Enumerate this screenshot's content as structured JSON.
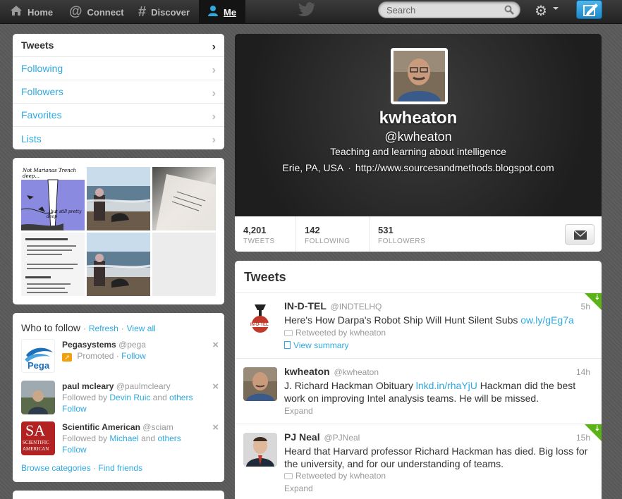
{
  "nav": {
    "home": "Home",
    "connect": "Connect",
    "discover": "Discover",
    "me": "Me"
  },
  "search": {
    "placeholder": "Search"
  },
  "dashboard": {
    "items": [
      {
        "label": "Tweets",
        "active": true
      },
      {
        "label": "Following"
      },
      {
        "label": "Followers"
      },
      {
        "label": "Favorites"
      },
      {
        "label": "Lists"
      }
    ]
  },
  "who_to_follow": {
    "title": "Who to follow",
    "refresh": "Refresh",
    "view_all": "View all",
    "dot": "·",
    "users": [
      {
        "name": "Pegasystems",
        "handle": "@pega",
        "note": "Promoted",
        "action": "Follow"
      },
      {
        "name": "paul mcleary",
        "handle": "@paulmcleary",
        "followed_prefix": "Followed by",
        "followed_by": "Devin Ruic",
        "and": "and",
        "others": "others",
        "action": "Follow"
      },
      {
        "name": "Scientific American",
        "handle": "@sciam",
        "followed_prefix": "Followed by",
        "followed_by": "Michael",
        "and": "and",
        "others": "others",
        "action": "Follow"
      }
    ],
    "browse": "Browse categories",
    "find": "Find friends",
    "sciam_logo_line1": "SA",
    "sciam_logo_line2": "SCIENTIFIC",
    "sciam_logo_line3": "AMERICAN",
    "pega_logo": "Pega"
  },
  "profile": {
    "name": "kwheaton",
    "handle": "@kwheaton",
    "bio": "Teaching and learning about intelligence",
    "location": "Erie, PA, USA",
    "separator": "·",
    "url": "http://www.sourcesandmethods.blogspot.com",
    "stats": [
      {
        "num": "4,201",
        "label": "TWEETS"
      },
      {
        "num": "142",
        "label": "FOLLOWING"
      },
      {
        "num": "531",
        "label": "FOLLOWERS"
      }
    ]
  },
  "tweets": {
    "title": "Tweets",
    "items": [
      {
        "name": "IN-D-TEL",
        "handle": "@INDTELHQ",
        "time": "5h",
        "text": "Here's How Darpa's Robot Ship Will Hunt Silent Subs ",
        "link": "ow.ly/gEg7a",
        "retweeted": "Retweeted by kwheaton",
        "action": "View summary",
        "logo": "IN-D-TEL"
      },
      {
        "name": "kwheaton",
        "handle": "@kwheaton",
        "time": "14h",
        "text_before": "J. Richard Hackman Obituary ",
        "link": "lnkd.in/rhaYjU",
        "text_after": " Hackman did the best work on improving Intel analysis teams. He will be missed.",
        "action": "Expand"
      },
      {
        "name": "PJ Neal",
        "handle": "@PJNeal",
        "time": "15h",
        "text": "Heard that Harvard professor Richard Hackman has died. Big loss for the university, and for our understanding of teams.",
        "retweeted": "Retweeted by kwheaton",
        "action": "Expand"
      }
    ]
  },
  "media_thumb_text": {
    "t1": "Not Marianas Trench deep...",
    "t1b": "...but still pretty deep"
  },
  "colors": {
    "link": "#2fa9e0",
    "retweet_green": "#5bb318",
    "promoted": "#f2a10c"
  },
  "icons": [
    "home-icon",
    "connect-icon",
    "discover-icon",
    "me-icon",
    "twitter-bird-icon",
    "search-icon",
    "gear-icon",
    "compose-icon",
    "chevron-right-icon",
    "close-icon",
    "envelope-icon",
    "retweet-icon",
    "summary-icon"
  ]
}
